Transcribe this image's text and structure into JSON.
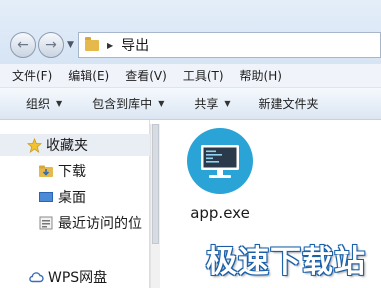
{
  "address": {
    "path": "导出"
  },
  "menu": [
    "文件(F)",
    "编辑(E)",
    "查看(V)",
    "工具(T)",
    "帮助(H)"
  ],
  "toolbar": {
    "organize": "组织",
    "include_in_library": "包含到库中",
    "share": "共享",
    "new_folder": "新建文件夹"
  },
  "nav": {
    "favorites": "收藏夹",
    "downloads": "下载",
    "desktop": "桌面",
    "recent": "最近访问的位",
    "wps": "WPS网盘"
  },
  "file": {
    "name": "app.exe",
    "icon": "monitor-app-icon",
    "icon_bg": "#2aa3d6"
  },
  "watermark": "极速下载站",
  "colors": {
    "accent": "#2aa3d6",
    "watermark_stroke": "#1a5fa8"
  }
}
